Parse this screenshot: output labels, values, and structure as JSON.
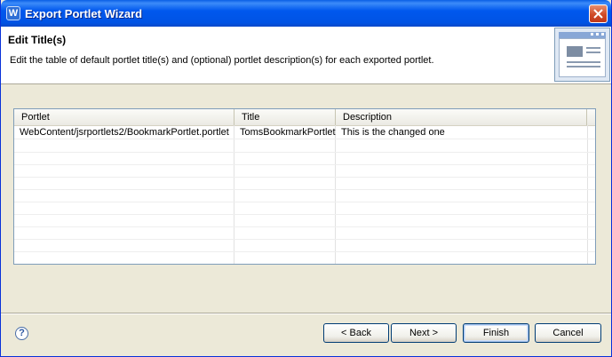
{
  "window": {
    "title": "Export Portlet Wizard",
    "icon_letter": "W"
  },
  "header": {
    "title": "Edit Title(s)",
    "description": "Edit the table of default portlet title(s) and (optional) portlet description(s) for each exported portlet."
  },
  "table": {
    "columns": [
      "Portlet",
      "Title",
      "Description"
    ],
    "rows": [
      {
        "portlet": "WebContent/jsrportlets2/BookmarkPortlet.portlet",
        "title": "TomsBookmarkPortlet",
        "description": "This is the changed one"
      }
    ]
  },
  "buttons": {
    "back": "< Back",
    "next": "Next >",
    "finish": "Finish",
    "cancel": "Cancel"
  },
  "help": {
    "glyph": "?"
  },
  "colors": {
    "titlebar": "#0058ee",
    "dialog_bg": "#ece9d8",
    "close_button": "#cf4b27"
  }
}
